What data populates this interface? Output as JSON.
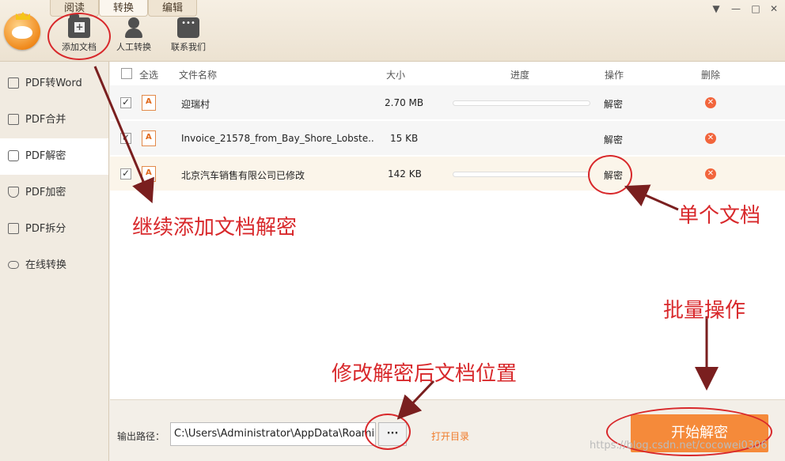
{
  "tabs": [
    "阅读",
    "转换",
    "编辑"
  ],
  "toolbar": [
    {
      "label": "添加文档",
      "icon": "add-folder-icon"
    },
    {
      "label": "人工转换",
      "icon": "person-icon"
    },
    {
      "label": "联系我们",
      "icon": "chat-icon"
    }
  ],
  "window_controls": [
    "▼",
    "—",
    "□",
    "✕"
  ],
  "sidebar": [
    {
      "label": "PDF转Word",
      "icon": "word-icon"
    },
    {
      "label": "PDF合并",
      "icon": "merge-icon"
    },
    {
      "label": "PDF解密",
      "icon": "lock-icon",
      "active": true
    },
    {
      "label": "PDF加密",
      "icon": "shield-icon"
    },
    {
      "label": "PDF拆分",
      "icon": "split-icon"
    },
    {
      "label": "在线转换",
      "icon": "cloud-icon"
    }
  ],
  "table": {
    "headers": {
      "select_all": "全选",
      "name": "文件名称",
      "size": "大小",
      "progress": "进度",
      "action": "操作",
      "delete": "删除"
    },
    "rows": [
      {
        "name": "迎瑞村",
        "size": "2.70 MB",
        "action": "解密",
        "checked": true
      },
      {
        "name": "Invoice_21578_from_Bay_Shore_Lobste..",
        "size": "15 KB",
        "action": "解密",
        "checked": true
      },
      {
        "name": "北京汽车销售有限公司已修改",
        "size": "142 KB",
        "action": "解密",
        "checked": true
      }
    ]
  },
  "footer": {
    "output_label": "输出路径：",
    "output_path": "C:\\Users\\Administrator\\AppData\\Roaming",
    "browse_label": "···",
    "open_dir": "打开目录",
    "start_button": "开始解密"
  },
  "annotations": {
    "add_more": "继续添加文档解密",
    "single": "单个文档",
    "batch": "批量操作",
    "change_location": "修改解密后文档位置"
  },
  "watermark": "https://blog.csdn.net/cocowei0306",
  "colors": {
    "accent": "#f58a3a",
    "annotation": "#d8282b",
    "delete": "#f2653c"
  }
}
